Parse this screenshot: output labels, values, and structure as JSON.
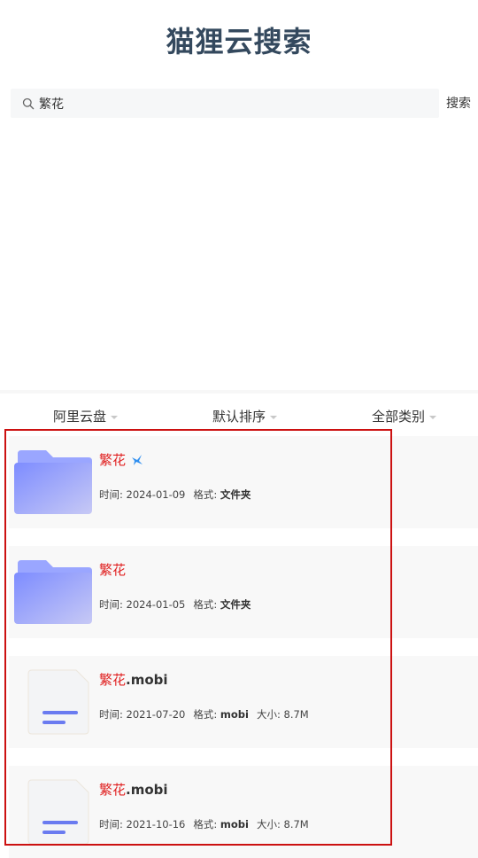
{
  "header": {
    "title": "猫狸云搜索"
  },
  "search": {
    "value": "繁花",
    "button_label": "搜索"
  },
  "filters": [
    {
      "label": "阿里云盘"
    },
    {
      "label": "默认排序"
    },
    {
      "label": "全部类别"
    }
  ],
  "labels": {
    "time": "时间: ",
    "format": "格式: ",
    "size": "大小: "
  },
  "results": [
    {
      "title": "繁花",
      "ext": "",
      "date": "2024-01-09",
      "format": "文件夹",
      "size": "",
      "type": "folder",
      "badge": "bird-icon"
    },
    {
      "title": "繁花",
      "ext": "",
      "date": "2024-01-05",
      "format": "文件夹",
      "size": "",
      "type": "folder"
    },
    {
      "title": "繁花",
      "ext": ".mobi",
      "date": "2021-07-20",
      "format": "mobi",
      "size": "8.7M",
      "type": "file"
    },
    {
      "title": "繁花",
      "ext": ".mobi",
      "date": "2021-10-16",
      "format": "mobi",
      "size": "8.7M",
      "type": "file"
    }
  ],
  "colors": {
    "title": "#34495e",
    "highlight": "#e02020",
    "selection": "#cc1111",
    "folder": "#8a98ff"
  }
}
